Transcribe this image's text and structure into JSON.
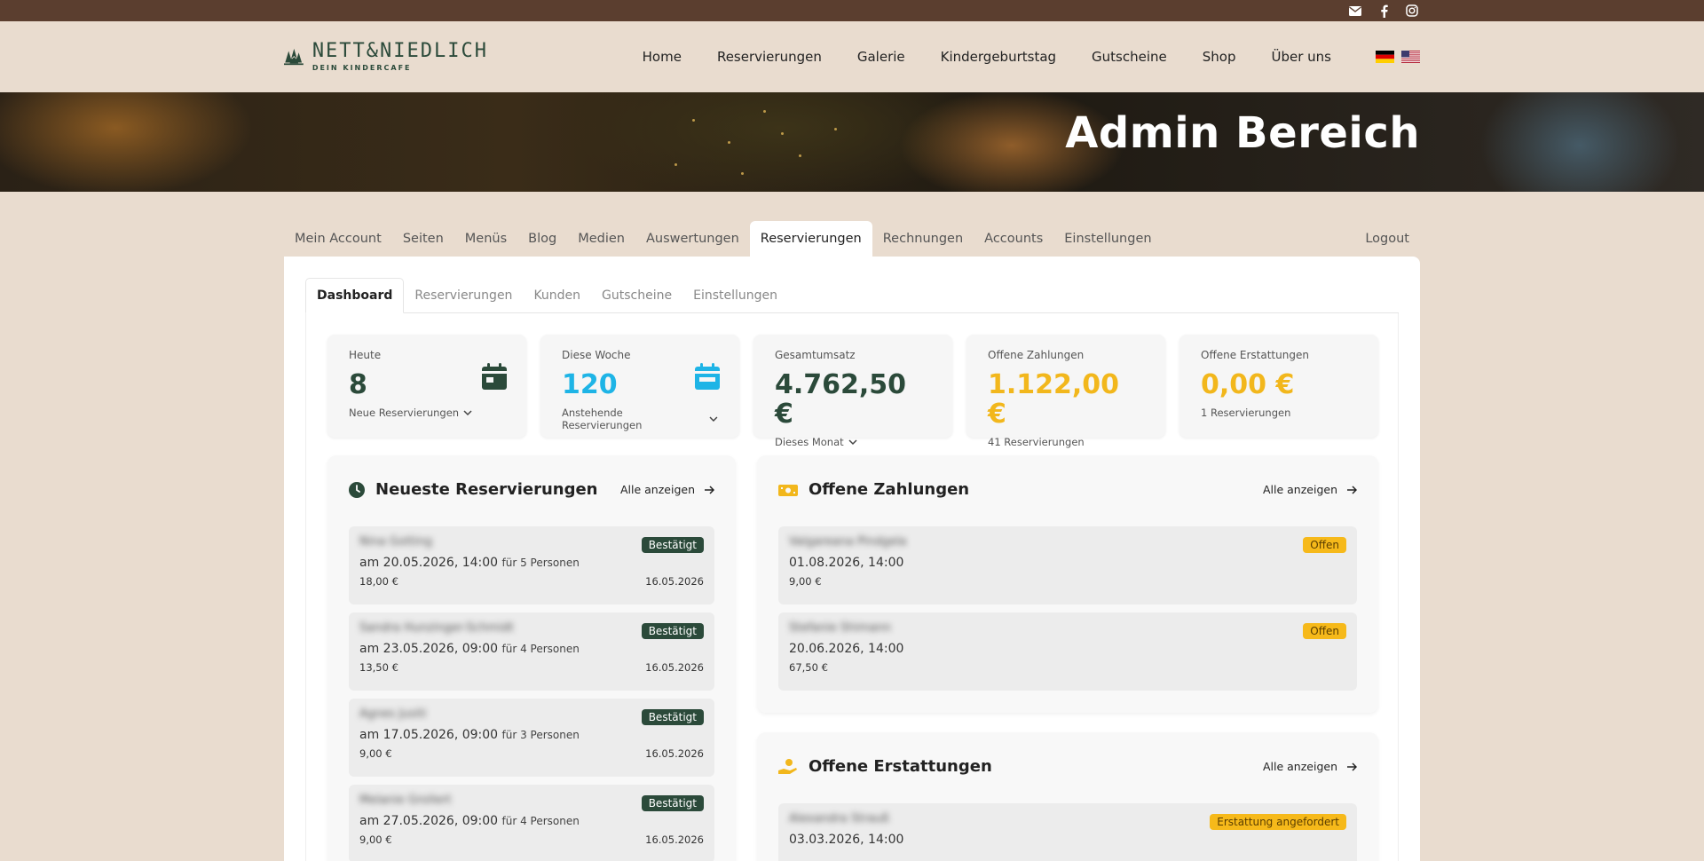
{
  "header": {
    "logo_main": "NETT&NIEDLICH",
    "logo_sub": "DEIN KINDERCAFE",
    "nav": [
      "Home",
      "Reservierungen",
      "Galerie",
      "Kindergeburtstag",
      "Gutscheine",
      "Shop",
      "Über uns"
    ],
    "social_icons": [
      "mail-icon",
      "facebook-icon",
      "instagram-icon"
    ]
  },
  "hero": {
    "title": "Admin Bereich"
  },
  "admin_tabs": [
    "Mein Account",
    "Seiten",
    "Menüs",
    "Blog",
    "Medien",
    "Auswertungen",
    "Reservierungen",
    "Rechnungen",
    "Accounts",
    "Einstellungen"
  ],
  "admin_active": "Reservierungen",
  "logout": "Logout",
  "sub_tabs": [
    "Dashboard",
    "Reservierungen",
    "Kunden",
    "Gutscheine",
    "Einstellungen"
  ],
  "stats": [
    {
      "label": "Heute",
      "value": "8",
      "sub": "Neue Reservierungen"
    },
    {
      "label": "Diese Woche",
      "value": "120",
      "sub": "Anstehende Reservierungen"
    },
    {
      "label": "Gesamtumsatz",
      "value": "4.762,50 €",
      "sub": "Dieses Monat"
    },
    {
      "label": "Offene Zahlungen",
      "value": "1.122,00 €",
      "sub": "41 Reservierungen"
    },
    {
      "label": "Offene Erstattungen",
      "value": "0,00 €",
      "sub": "1 Reservierungen"
    }
  ],
  "latest": {
    "title": "Neueste Reservierungen",
    "all": "Alle anzeigen",
    "items": [
      {
        "name": "Nina Gotting",
        "date": "am 20.05.2026, 14:00",
        "persons": "für 5 Personen",
        "price": "18,00 €",
        "created": "16.05.2026",
        "status": "Bestätigt"
      },
      {
        "name": "Sandra Hunzinger-Schmidt",
        "date": "am 23.05.2026, 09:00",
        "persons": "für 4 Personen",
        "price": "13,50 €",
        "created": "16.05.2026",
        "status": "Bestätigt"
      },
      {
        "name": "Agnes Jusiti",
        "date": "am 17.05.2026, 09:00",
        "persons": "für 3 Personen",
        "price": "9,00 €",
        "created": "16.05.2026",
        "status": "Bestätigt"
      },
      {
        "name": "Melanie Grollert",
        "date": "am 27.05.2026, 09:00",
        "persons": "für 4 Personen",
        "price": "9,00 €",
        "created": "16.05.2026",
        "status": "Bestätigt"
      }
    ]
  },
  "open_payments": {
    "title": "Offene Zahlungen",
    "all": "Alle anzeigen",
    "items": [
      {
        "name": "Valgareana Pindgela",
        "date": "01.08.2026, 14:00",
        "price": "9,00 €",
        "status": "Offen"
      },
      {
        "name": "Stefanie Shimann",
        "date": "20.06.2026, 14:00",
        "price": "67,50 €",
        "status": "Offen"
      }
    ]
  },
  "open_refunds": {
    "title": "Offene Erstattungen",
    "all": "Alle anzeigen",
    "items": [
      {
        "name": "Alexandra Strauß",
        "date": "03.03.2026, 14:00",
        "status": "Erstattung angefordert"
      }
    ]
  },
  "colors": {
    "brown": "#5b3e2f",
    "green": "#2b4a3a",
    "blue": "#1eb4e6",
    "yellow": "#f2b71c",
    "beige": "#e9dccf"
  }
}
